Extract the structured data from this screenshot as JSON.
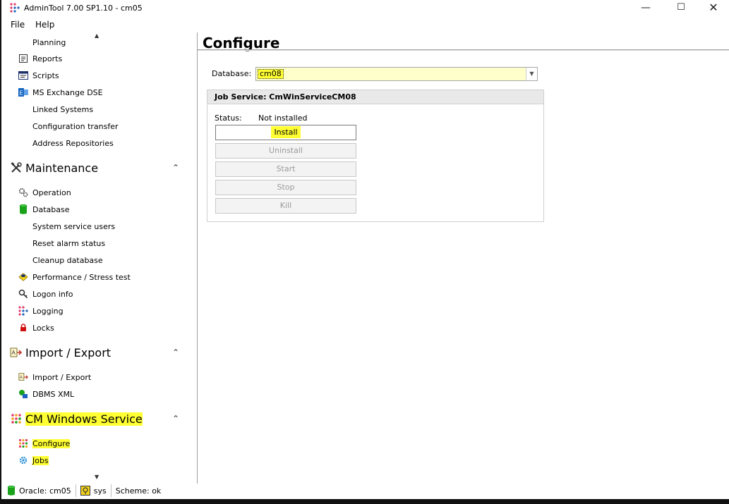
{
  "window": {
    "title": "AdminTool 7.00 SP1.10 - cm05",
    "minimize": "—",
    "maximize": "☐",
    "close": "✕"
  },
  "menu": {
    "file": "File",
    "help": "Help"
  },
  "sidebar": {
    "partial_item": "Planning",
    "items_top": [
      {
        "label": "Reports",
        "icon": "report-icon"
      },
      {
        "label": "Scripts",
        "icon": "script-icon"
      },
      {
        "label": "MS Exchange DSE",
        "icon": "exchange-icon"
      },
      {
        "label": "Linked Systems",
        "icon": ""
      },
      {
        "label": "Configuration transfer",
        "icon": ""
      },
      {
        "label": "Address Repositories",
        "icon": ""
      }
    ],
    "sections": {
      "maintenance": {
        "title": "Maintenance",
        "items": [
          {
            "label": "Operation",
            "icon": "gears-icon"
          },
          {
            "label": "Database",
            "icon": "database-icon"
          },
          {
            "label": "System service users",
            "icon": ""
          },
          {
            "label": "Reset alarm status",
            "icon": ""
          },
          {
            "label": "Cleanup database",
            "icon": ""
          },
          {
            "label": "Performance / Stress test",
            "icon": "cpu-icon"
          },
          {
            "label": "Logon info",
            "icon": "key-icon"
          },
          {
            "label": "Logging",
            "icon": "logging-icon"
          },
          {
            "label": "Locks",
            "icon": "lock-icon"
          }
        ]
      },
      "import_export": {
        "title": "Import / Export",
        "items": [
          {
            "label": "Import / Export",
            "icon": "import-export-icon"
          },
          {
            "label": "DBMS XML",
            "icon": "dbms-xml-icon"
          }
        ]
      },
      "cm_windows_service": {
        "title": "CM Windows Service",
        "items": [
          {
            "label": "Configure",
            "icon": "configure-icon"
          },
          {
            "label": "Jobs",
            "icon": "jobs-gear-icon"
          }
        ]
      }
    }
  },
  "main": {
    "title": "Configure",
    "database_label": "Database:",
    "database_value": "cm08",
    "group_title": "Job Service: CmWinServiceCM08",
    "status_label": "Status:",
    "status_value": "Not installed",
    "buttons": {
      "install": "Install",
      "uninstall": "Uninstall",
      "start": "Start",
      "stop": "Stop",
      "kill": "Kill"
    }
  },
  "statusbar": {
    "connection": "Oracle: cm05",
    "user": "sys",
    "scheme": "Scheme: ok"
  },
  "colors": {
    "highlight": "#ffff33",
    "select_bg": "#ffffcc",
    "db_green": "#1aa31a",
    "lock_red": "#d01010"
  }
}
